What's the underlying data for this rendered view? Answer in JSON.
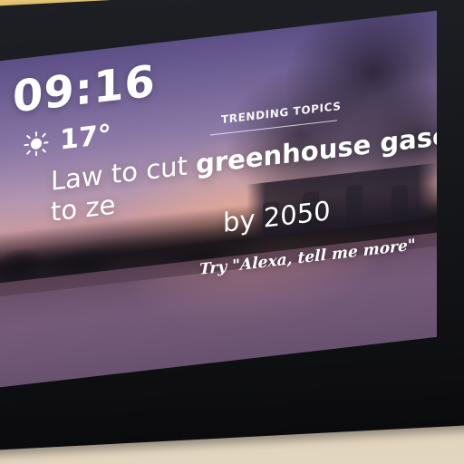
{
  "clock": {
    "time": "09:16"
  },
  "weather": {
    "temperature": "17°",
    "icon": "sun-icon"
  },
  "trending": {
    "section_label": "TRENDING TOPICS"
  },
  "headline": {
    "pre": "Law to cut ",
    "strong": "greenhouse gases",
    "post": " to ze",
    "line2": "by 2050"
  },
  "prompt": {
    "hint": "Try \"Alexa, tell me more\""
  }
}
